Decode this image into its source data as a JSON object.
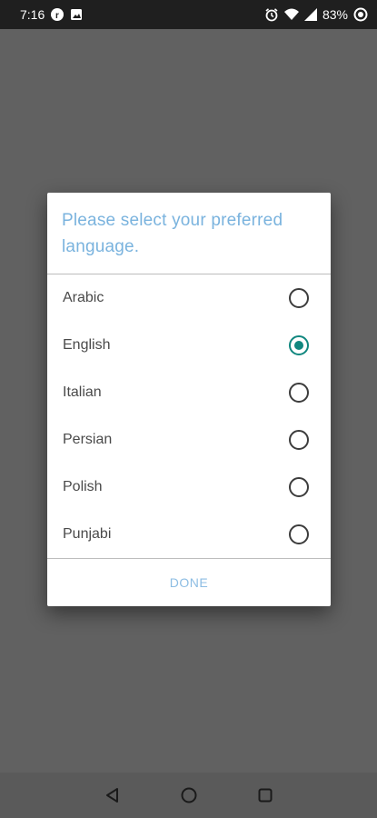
{
  "status_bar": {
    "time": "7:16",
    "battery_percent": "83%",
    "icons": [
      "app-notification-icon",
      "image-notification-icon",
      "alarm-icon",
      "wifi-icon",
      "signal-icon",
      "battery-icon"
    ]
  },
  "dialog": {
    "title": "Please select your preferred language.",
    "options": [
      {
        "label": "Arabic",
        "selected": false
      },
      {
        "label": "English",
        "selected": true
      },
      {
        "label": "Italian",
        "selected": false
      },
      {
        "label": "Persian",
        "selected": false
      },
      {
        "label": "Polish",
        "selected": false
      },
      {
        "label": "Punjabi",
        "selected": false
      }
    ],
    "done_label": "DONE"
  },
  "nav_bar": {
    "icons": [
      "back-icon",
      "home-icon",
      "recents-icon"
    ]
  },
  "colors": {
    "accent": "#11877f",
    "title": "#7ab3de",
    "button": "#8dbde3",
    "scrim": "#616161"
  }
}
